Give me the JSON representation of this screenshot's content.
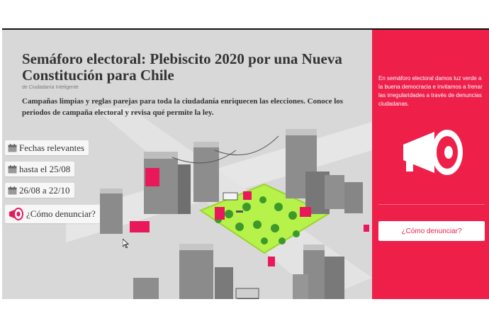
{
  "page": {
    "title": "Semáforo electoral: Plebiscito 2020 por una Nueva Constitución para Chile",
    "subtitle": "de Ciudadanía Inteligente",
    "intro": "Campañas limpias y reglas parejas para toda la ciudadanía enriquecen las elecciones. Conoce los periodos de campaña electoral y revisa qué permite la ley."
  },
  "menu": {
    "items": [
      {
        "label": "Fechas relevantes",
        "icon": "calendar-icon"
      },
      {
        "label": "hasta el 25/08",
        "icon": "calendar-icon"
      },
      {
        "label": "26/08 a 22/10",
        "icon": "calendar-icon"
      },
      {
        "label": "¿Cómo denunciar?",
        "icon": "megaphone-icon"
      }
    ]
  },
  "sidebar": {
    "text": "En semáforo electoral damos luz verde a la buena democracia e invitamos a frenar las irregularidades a través de denuncias ciudadanas.",
    "button_label": "¿Cómo denunciar?",
    "icon": "megaphone-icon"
  },
  "colors": {
    "accent": "#ee1f49",
    "park": "#b7f24a",
    "background": "#d8d8d8"
  }
}
